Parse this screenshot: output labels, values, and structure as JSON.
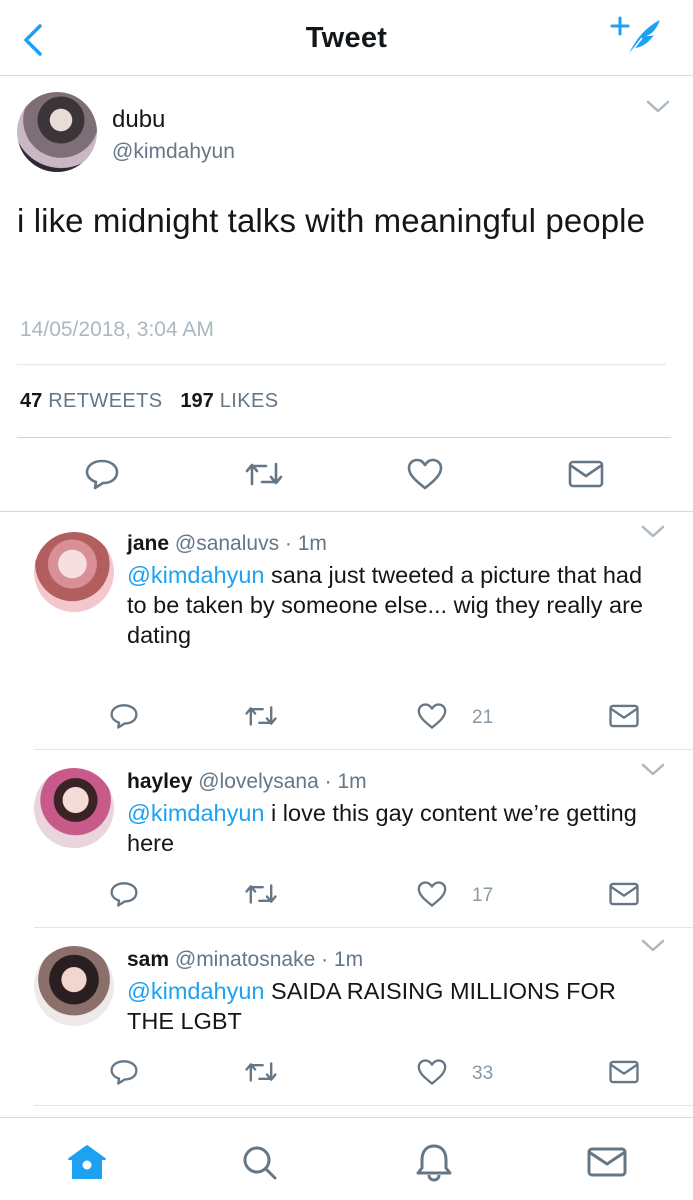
{
  "nav": {
    "title": "Tweet",
    "back_icon": "chevron-left-icon",
    "compose_icon": "compose-feather-icon"
  },
  "tweet": {
    "name": "dubu",
    "handle": "@kimdahyun",
    "text": "i like midnight talks with meaningful people",
    "date": "14/05/2018, 3:04 AM",
    "retweets": "47",
    "retweets_label": "RETWEETS",
    "likes": "197",
    "likes_label": "LIKES"
  },
  "replies": [
    {
      "name": "jane",
      "handle": "@sanaluvs",
      "time": "· 1m",
      "mention": "@kimdahyun",
      "text": " sana just tweeted a picture that had to be taken by someone else... wig they really are dating",
      "likes": "21"
    },
    {
      "name": "hayley",
      "handle": "@lovelysana",
      "time": "· 1m",
      "mention": "@kimdahyun",
      "text": " i love this gay content we’re getting here",
      "likes": "17"
    },
    {
      "name": "sam",
      "handle": "@minatosnake",
      "time": "· 1m",
      "mention": "@kimdahyun",
      "text": " SAIDA RAISING MILLIONS FOR THE LGBT",
      "likes": "33"
    }
  ],
  "tabbar": {
    "items": [
      "home-icon",
      "search-icon",
      "notifications-icon",
      "messages-icon"
    ]
  },
  "colors": {
    "accent": "#1da1f2",
    "secondary_text": "#657786",
    "icon_gray": "#657786"
  }
}
